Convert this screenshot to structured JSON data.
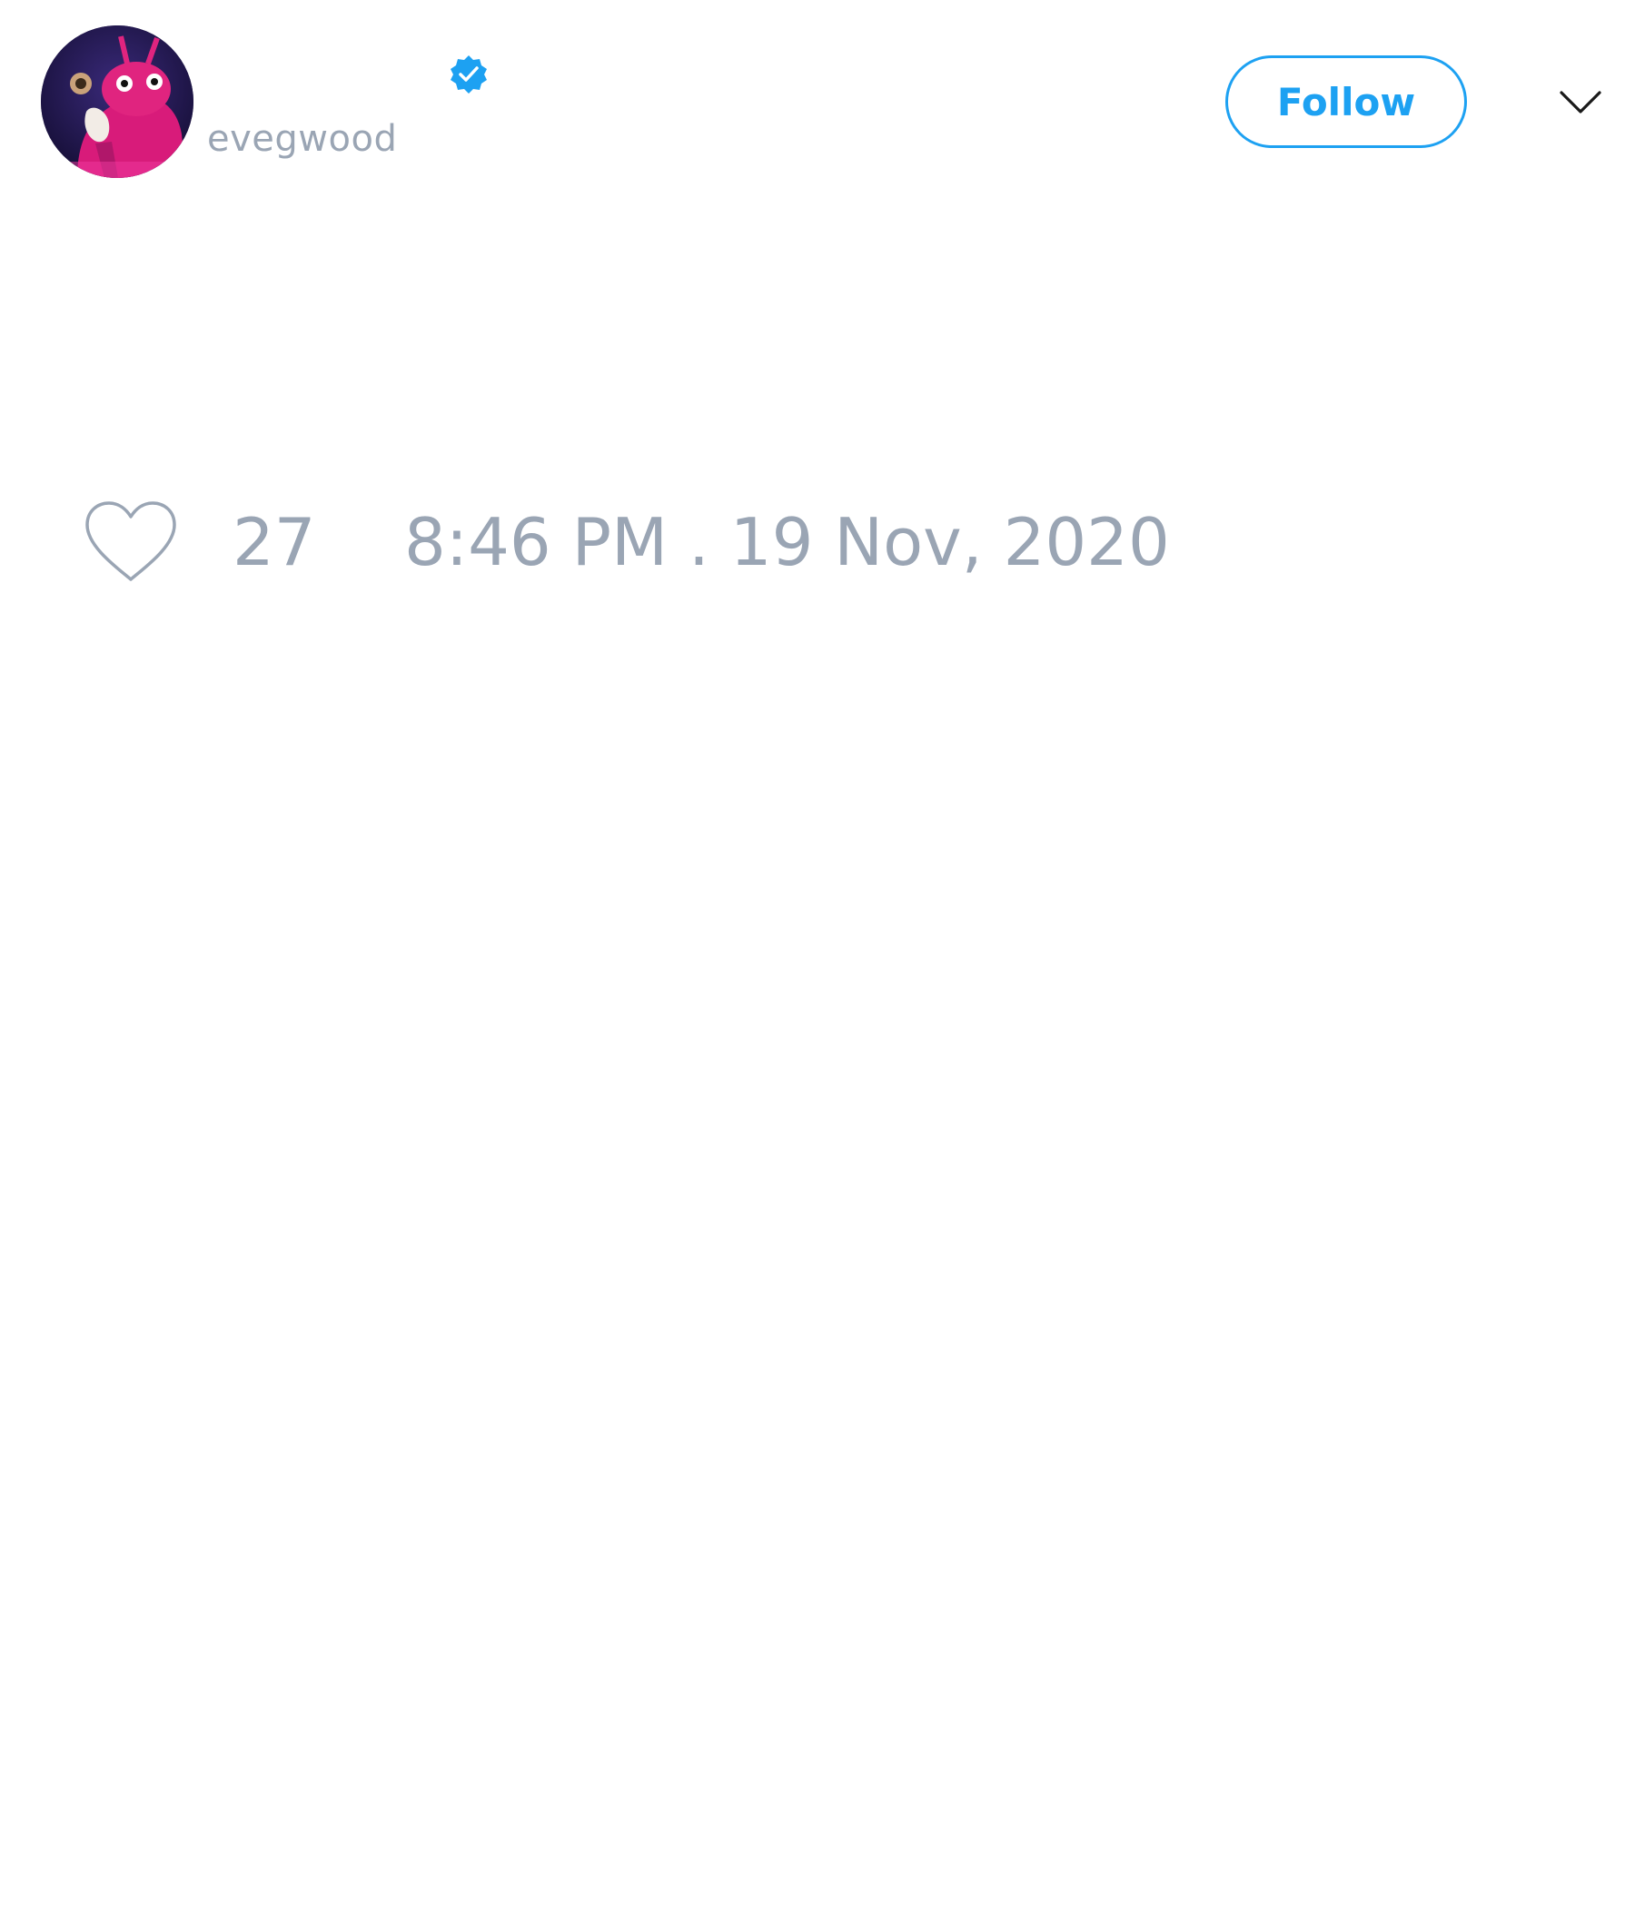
{
  "tweet": {
    "author": {
      "handle": "evegwood",
      "verified": true,
      "avatar_icon": "pink-creature-avatar"
    },
    "follow_label": "Follow",
    "menu_icon": "chevron-down-icon",
    "likes": {
      "icon": "heart-icon",
      "count": "27"
    },
    "timestamp": "8:46 PM . 19 Nov, 2020"
  },
  "colors": {
    "accent": "#1da1f2",
    "muted_text": "#9aa5b4",
    "background": "#ffffff"
  }
}
